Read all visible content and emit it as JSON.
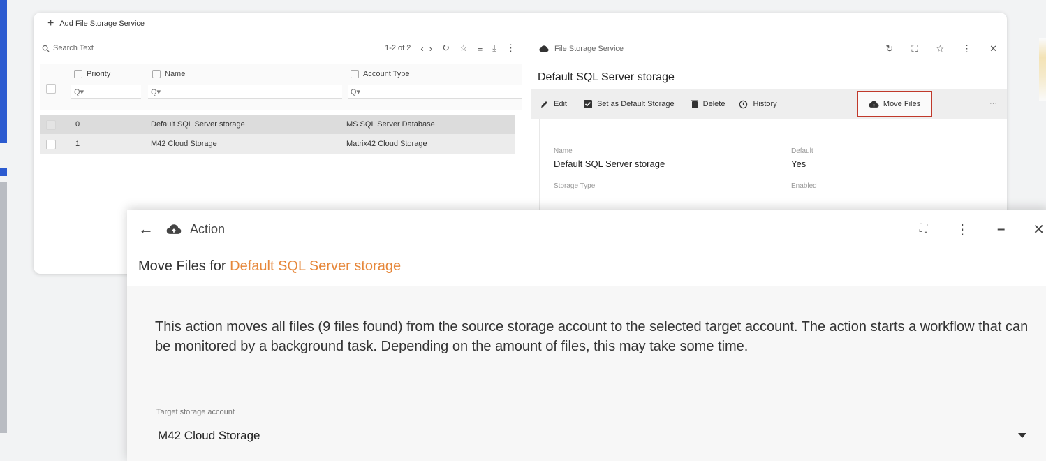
{
  "bg_window": {
    "add_label": "Add File Storage Service",
    "list": {
      "search_placeholder": "Search Text",
      "pager": "1-2 of 2",
      "columns": [
        "Priority",
        "Name",
        "Account Type"
      ],
      "filter_glyph": "Q▾",
      "rows": [
        {
          "priority": "0",
          "name": "Default SQL Server storage",
          "account_type": "MS SQL Server Database"
        },
        {
          "priority": "1",
          "name": "M42 Cloud Storage",
          "account_type": "Matrix42 Cloud Storage"
        }
      ]
    },
    "detail": {
      "header": "File Storage Service",
      "title": "Default SQL Server storage",
      "actions": {
        "edit": "Edit",
        "set_default": "Set as Default Storage",
        "delete": "Delete",
        "history": "History",
        "move_files": "Move Files",
        "more": "···"
      },
      "fields": {
        "name_label": "Name",
        "name_value": "Default SQL Server storage",
        "default_label": "Default",
        "default_value": "Yes",
        "storage_type_label": "Storage Type",
        "enabled_label": "Enabled"
      }
    }
  },
  "dialog": {
    "title": "Action",
    "subtitle_prefix": "Move Files for",
    "subtitle_highlight": "Default SQL Server storage",
    "description": "This action moves all files (9 files found) from the source storage account to the selected target account. The action starts a workflow that can be monitored by a background task. Depending on the amount of files, this may take some time.",
    "target_label": "Target storage account",
    "target_value": "M42 Cloud Storage"
  },
  "colors": {
    "highlight": "#e6873a",
    "move_files_border": "#c0392b",
    "edge_blue": "#2c5bd0"
  }
}
